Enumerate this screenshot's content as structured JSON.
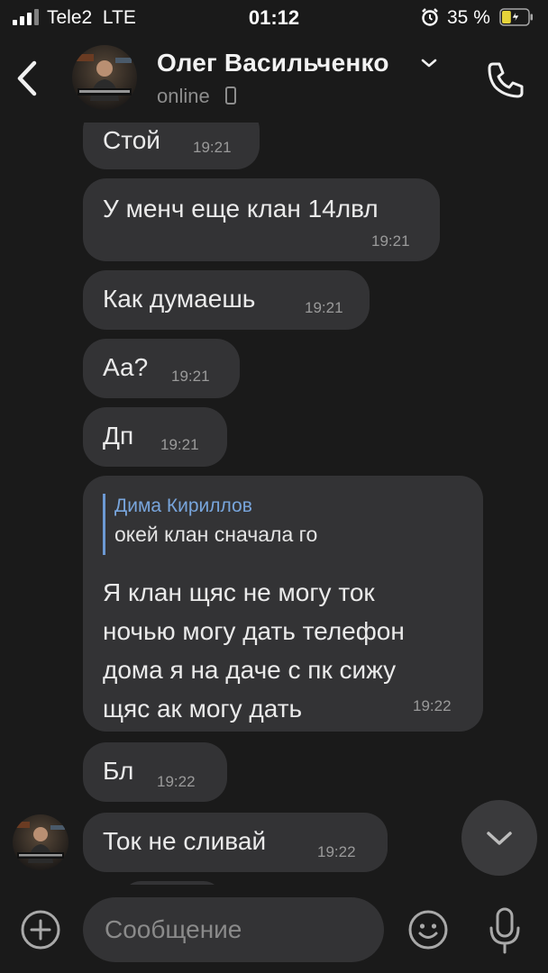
{
  "status_bar": {
    "carrier": "Tele2  LTE",
    "time": "01:12",
    "battery_percent": "35 %",
    "battery_level": 0.35,
    "icons": [
      "signal-icon",
      "alarm-icon",
      "battery-icon"
    ]
  },
  "header": {
    "name": "Олег Васильченко",
    "status": "online",
    "icons": [
      "back-icon",
      "avatar",
      "chevron-down-icon",
      "phone-icon"
    ]
  },
  "messages": [
    {
      "text": "Стой",
      "time": "19:21"
    },
    {
      "text": "У менч еще клан 14лвл",
      "time": "19:21"
    },
    {
      "text": "Как думаешь",
      "time": "19:21"
    },
    {
      "text": "Аа?",
      "time": "19:21"
    },
    {
      "text": "Дп",
      "time": "19:21"
    },
    {
      "reply_author": "Дима Кириллов",
      "reply_text": "окей клан сначала го",
      "text": "Я клан щяс не могу ток\nночью могу дать телефон\nдома я на даче с пк сижу\nщяс ак могу дать",
      "time": "19:22"
    },
    {
      "text": "Бл",
      "time": "19:22"
    },
    {
      "text": "Ток не сливай",
      "time": "19:22"
    }
  ],
  "composer": {
    "placeholder": "Сообщение",
    "value": "",
    "icons": [
      "plus-icon",
      "emoji-icon",
      "mic-icon"
    ]
  },
  "colors": {
    "background": "#1a1a1a",
    "bubble": "#333335",
    "reply_accent": "#6c99d4",
    "secondary_text": "#9a9a9a"
  }
}
